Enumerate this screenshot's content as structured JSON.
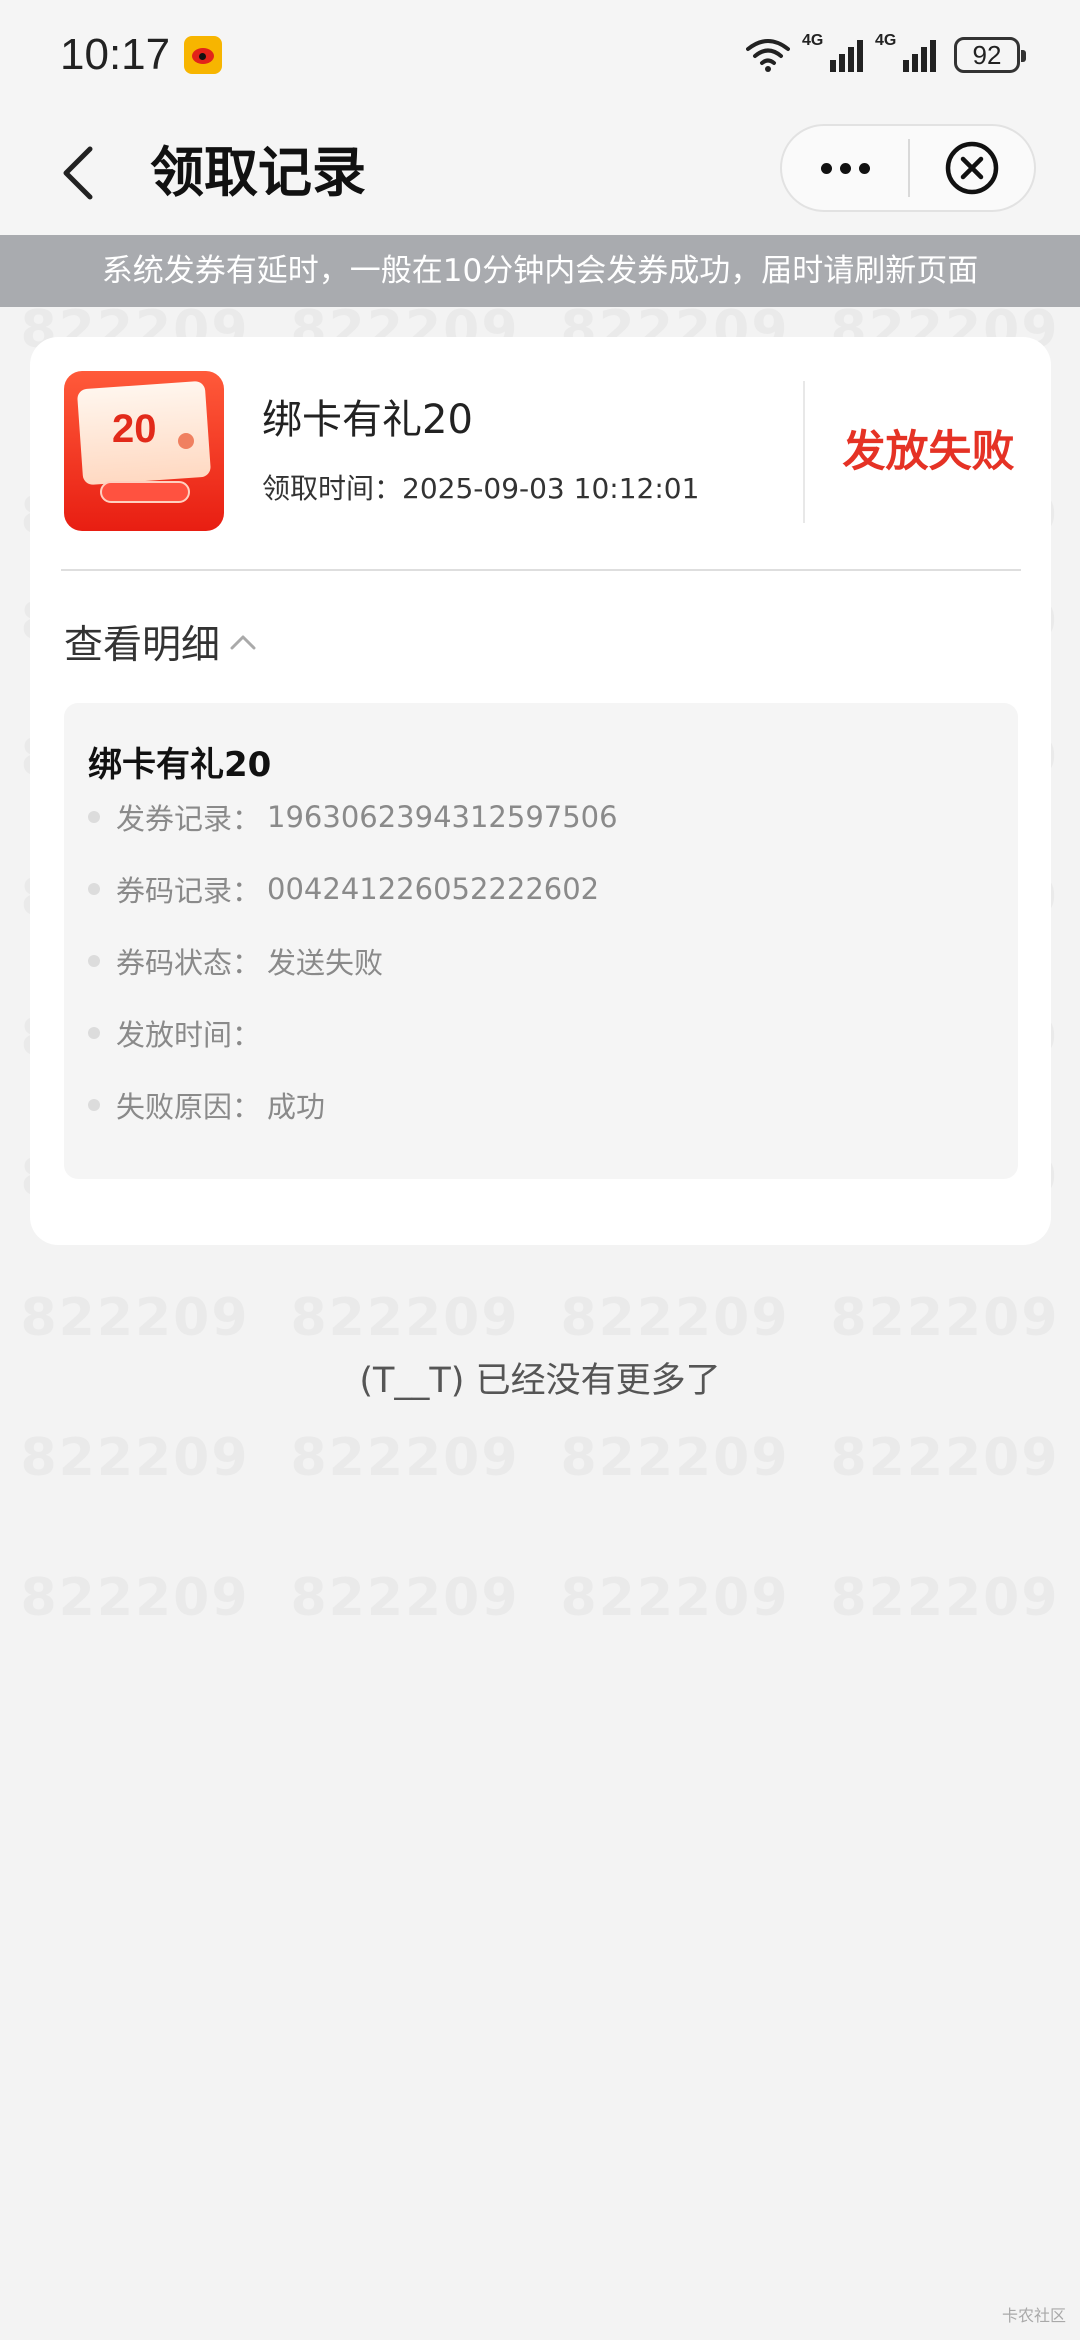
{
  "status_bar": {
    "time": "10:17",
    "signal1_label": "4G",
    "signal2_label": "4G",
    "battery": "92"
  },
  "nav": {
    "title": "领取记录"
  },
  "notice": "系统发券有延时，一般在10分钟内会发券成功，届时请刷新页面",
  "watermark": "822209",
  "card": {
    "coupon_amount": "20",
    "coupon_name": "绑卡有礼20",
    "claim_time_label": "领取时间：",
    "claim_time_value": "2025-09-03 10:12:01",
    "status": "发放失败",
    "detail_toggle": "查看明细",
    "detail": {
      "title": "绑卡有礼20",
      "rows": [
        {
          "label": "发券记录：",
          "value": "1963062394312597506"
        },
        {
          "label": "券码记录：",
          "value": "004241226052222602"
        },
        {
          "label": "券码状态：",
          "value": "发送失败"
        },
        {
          "label": "发放时间：",
          "value": ""
        },
        {
          "label": "失败原因：",
          "value": "成功"
        }
      ]
    }
  },
  "footer": {
    "no_more": "(T__T) 已经没有更多了"
  },
  "corner_mark": "卡农社区"
}
